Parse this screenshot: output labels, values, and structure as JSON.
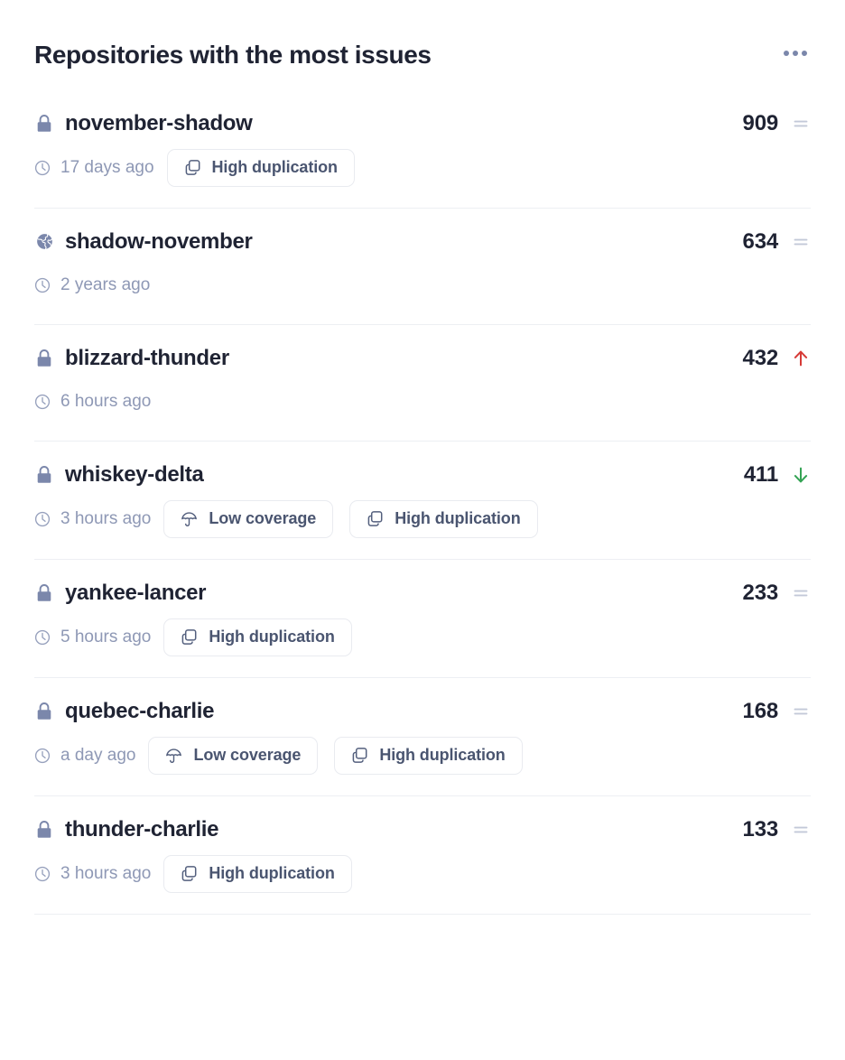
{
  "header": {
    "title": "Repositories with the most issues",
    "menu_icon": "ellipsis-horizontal-icon"
  },
  "colors": {
    "text_primary": "#1f2333",
    "text_muted": "#8e98b5",
    "icon_slate": "#7b87ab",
    "badge_text": "#4a5570",
    "badge_border": "#e9ebf0",
    "divider": "#edeff3",
    "trend_flat": "#c3c9d8",
    "trend_up": "#d63a36",
    "trend_down": "#34a354"
  },
  "repositories": [
    {
      "name": "november-shadow",
      "visibility": "private",
      "visibility_icon": "lock-icon",
      "updated": "17 days ago",
      "badges": [
        {
          "label": "High duplication",
          "icon": "copy-icon"
        }
      ],
      "count": "909",
      "trend": "flat",
      "trend_icon": "equals-icon"
    },
    {
      "name": "shadow-november",
      "visibility": "public",
      "visibility_icon": "globe-icon",
      "updated": "2 years ago",
      "badges": [],
      "count": "634",
      "trend": "flat",
      "trend_icon": "equals-icon"
    },
    {
      "name": "blizzard-thunder",
      "visibility": "private",
      "visibility_icon": "lock-icon",
      "updated": "6 hours ago",
      "badges": [],
      "count": "432",
      "trend": "up",
      "trend_icon": "arrow-up-icon"
    },
    {
      "name": "whiskey-delta",
      "visibility": "private",
      "visibility_icon": "lock-icon",
      "updated": "3 hours ago",
      "badges": [
        {
          "label": "Low coverage",
          "icon": "umbrella-icon"
        },
        {
          "label": "High duplication",
          "icon": "copy-icon"
        }
      ],
      "count": "411",
      "trend": "down",
      "trend_icon": "arrow-down-icon"
    },
    {
      "name": "yankee-lancer",
      "visibility": "private",
      "visibility_icon": "lock-icon",
      "updated": "5 hours ago",
      "badges": [
        {
          "label": "High duplication",
          "icon": "copy-icon"
        }
      ],
      "count": "233",
      "trend": "flat",
      "trend_icon": "equals-icon"
    },
    {
      "name": "quebec-charlie",
      "visibility": "private",
      "visibility_icon": "lock-icon",
      "updated": "a day ago",
      "badges": [
        {
          "label": "Low coverage",
          "icon": "umbrella-icon"
        },
        {
          "label": "High duplication",
          "icon": "copy-icon"
        }
      ],
      "count": "168",
      "trend": "flat",
      "trend_icon": "equals-icon"
    },
    {
      "name": "thunder-charlie",
      "visibility": "private",
      "visibility_icon": "lock-icon",
      "updated": "3 hours ago",
      "badges": [
        {
          "label": "High duplication",
          "icon": "copy-icon"
        }
      ],
      "count": "133",
      "trend": "flat",
      "trend_icon": "equals-icon"
    }
  ]
}
